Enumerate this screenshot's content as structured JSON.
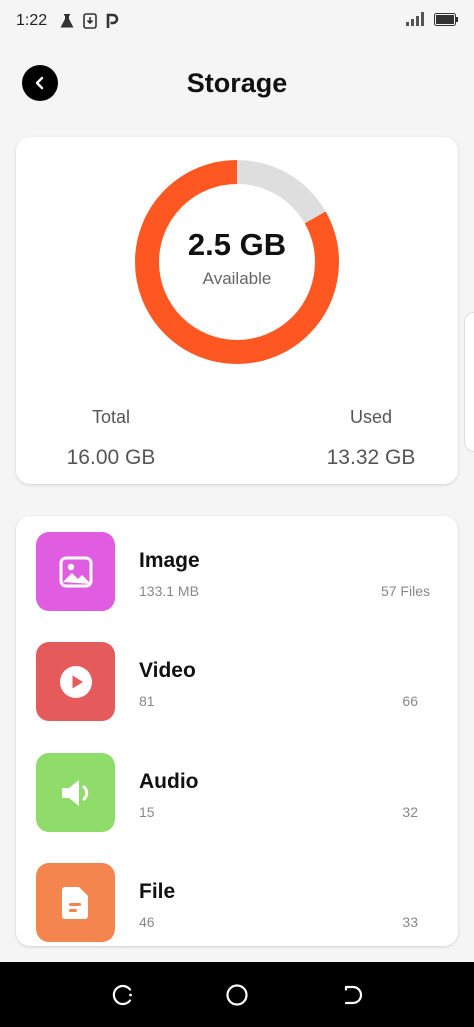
{
  "status_bar": {
    "time": "1:22"
  },
  "header": {
    "title": "Storage"
  },
  "storage": {
    "available_value": "2.5 GB",
    "available_label": "Available",
    "total_label": "Total",
    "total_value": "16.00 GB",
    "used_label": "Used",
    "used_value": "13.32 GB",
    "used_fraction": 0.8325,
    "used_color": "#ff5722",
    "free_color": "#dedede"
  },
  "categories": [
    {
      "name": "Image",
      "size": "133.1 MB",
      "count": "57 Files",
      "color": "#e05ce0",
      "icon": "image-icon"
    },
    {
      "name": "Video",
      "size": "81",
      "count": "66",
      "color": "#e55a5a",
      "icon": "play-icon"
    },
    {
      "name": "Audio",
      "size": "15",
      "count": "32",
      "color": "#8fdc6b",
      "icon": "speaker-icon"
    },
    {
      "name": "File",
      "size": "46",
      "count": "33",
      "color": "#f5854f",
      "icon": "document-icon"
    }
  ]
}
